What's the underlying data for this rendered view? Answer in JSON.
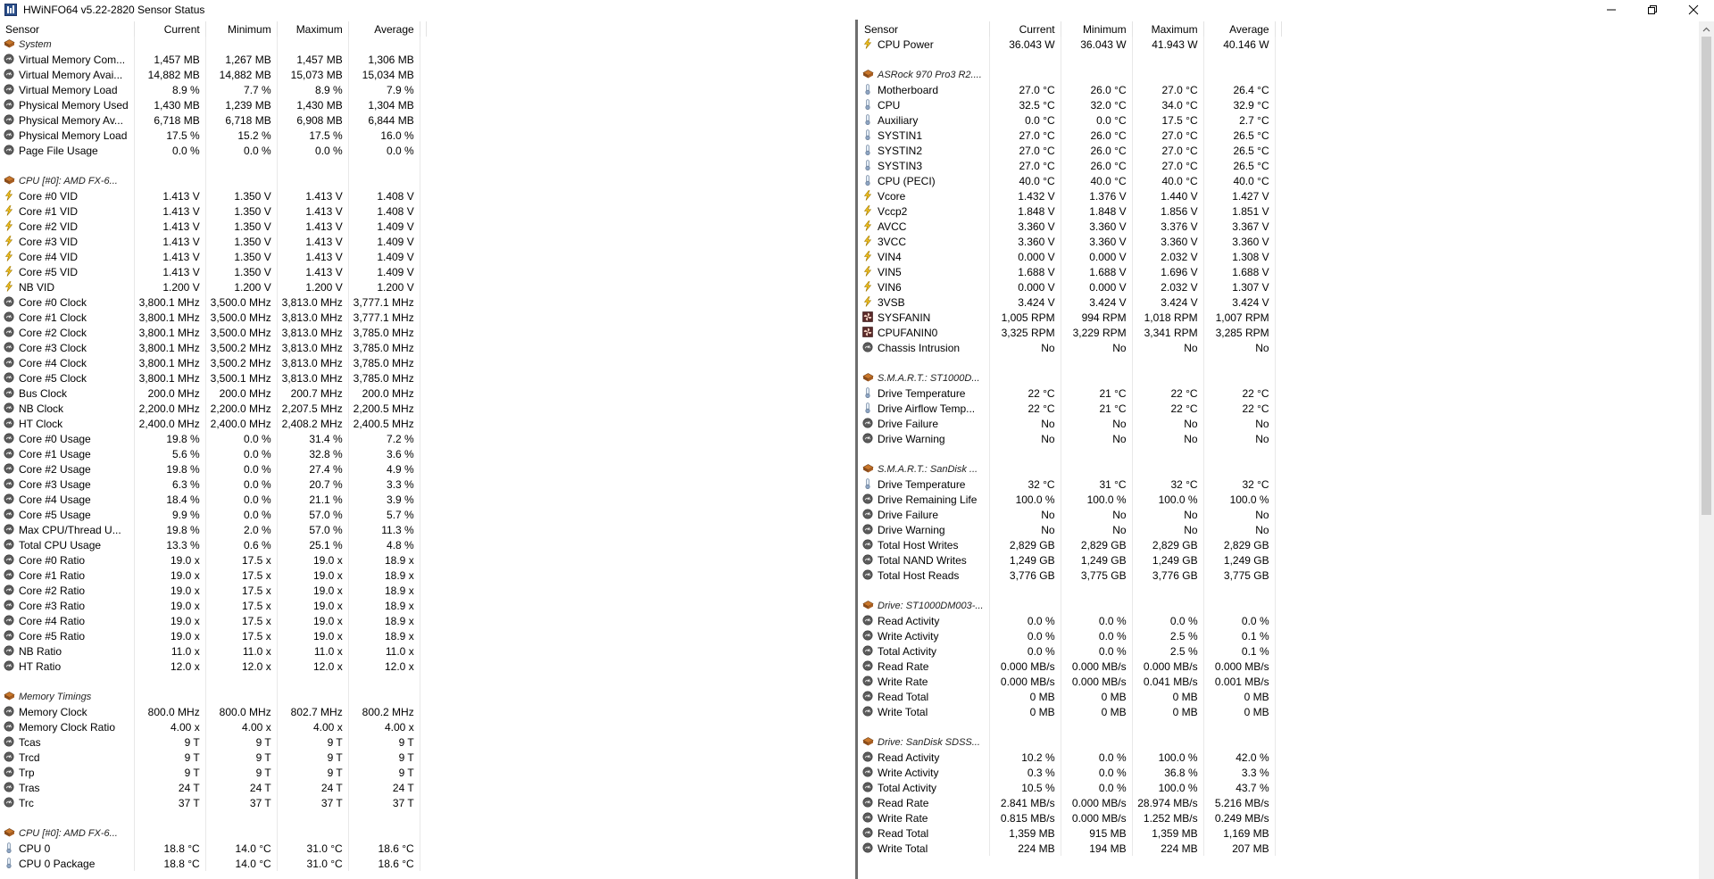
{
  "window": {
    "title": "HWiNFO64 v5.22-2820 Sensor Status"
  },
  "columns": [
    "Sensor",
    "Current",
    "Minimum",
    "Maximum",
    "Average"
  ],
  "left_rows": [
    {
      "type": "section",
      "name": "System"
    },
    {
      "type": "row",
      "icon": "circle",
      "name": "Virtual Memory Com...",
      "cur": "1,457 MB",
      "min": "1,267 MB",
      "max": "1,457 MB",
      "avg": "1,306 MB"
    },
    {
      "type": "row",
      "icon": "circle",
      "name": "Virtual Memory Avai...",
      "cur": "14,882 MB",
      "min": "14,882 MB",
      "max": "15,073 MB",
      "avg": "15,034 MB"
    },
    {
      "type": "row",
      "icon": "circle",
      "name": "Virtual Memory Load",
      "cur": "8.9 %",
      "min": "7.7 %",
      "max": "8.9 %",
      "avg": "7.9 %"
    },
    {
      "type": "row",
      "icon": "circle",
      "name": "Physical Memory Used",
      "cur": "1,430 MB",
      "min": "1,239 MB",
      "max": "1,430 MB",
      "avg": "1,304 MB"
    },
    {
      "type": "row",
      "icon": "circle",
      "name": "Physical Memory Av...",
      "cur": "6,718 MB",
      "min": "6,718 MB",
      "max": "6,908 MB",
      "avg": "6,844 MB"
    },
    {
      "type": "row",
      "icon": "circle",
      "name": "Physical Memory Load",
      "cur": "17.5 %",
      "min": "15.2 %",
      "max": "17.5 %",
      "avg": "16.0 %"
    },
    {
      "type": "row",
      "icon": "circle",
      "name": "Page File Usage",
      "cur": "0.0 %",
      "min": "0.0 %",
      "max": "0.0 %",
      "avg": "0.0 %"
    },
    {
      "type": "blank"
    },
    {
      "type": "section",
      "name": "CPU [#0]: AMD FX-6..."
    },
    {
      "type": "row",
      "icon": "bolt",
      "name": "Core #0 VID",
      "cur": "1.413 V",
      "min": "1.350 V",
      "max": "1.413 V",
      "avg": "1.408 V"
    },
    {
      "type": "row",
      "icon": "bolt",
      "name": "Core #1 VID",
      "cur": "1.413 V",
      "min": "1.350 V",
      "max": "1.413 V",
      "avg": "1.408 V"
    },
    {
      "type": "row",
      "icon": "bolt",
      "name": "Core #2 VID",
      "cur": "1.413 V",
      "min": "1.350 V",
      "max": "1.413 V",
      "avg": "1.409 V"
    },
    {
      "type": "row",
      "icon": "bolt",
      "name": "Core #3 VID",
      "cur": "1.413 V",
      "min": "1.350 V",
      "max": "1.413 V",
      "avg": "1.409 V"
    },
    {
      "type": "row",
      "icon": "bolt",
      "name": "Core #4 VID",
      "cur": "1.413 V",
      "min": "1.350 V",
      "max": "1.413 V",
      "avg": "1.409 V"
    },
    {
      "type": "row",
      "icon": "bolt",
      "name": "Core #5 VID",
      "cur": "1.413 V",
      "min": "1.350 V",
      "max": "1.413 V",
      "avg": "1.409 V"
    },
    {
      "type": "row",
      "icon": "bolt",
      "name": "NB VID",
      "cur": "1.200 V",
      "min": "1.200 V",
      "max": "1.200 V",
      "avg": "1.200 V"
    },
    {
      "type": "row",
      "icon": "circle",
      "name": "Core #0 Clock",
      "cur": "3,800.1 MHz",
      "min": "3,500.0 MHz",
      "max": "3,813.0 MHz",
      "avg": "3,777.1 MHz"
    },
    {
      "type": "row",
      "icon": "circle",
      "name": "Core #1 Clock",
      "cur": "3,800.1 MHz",
      "min": "3,500.0 MHz",
      "max": "3,813.0 MHz",
      "avg": "3,777.1 MHz"
    },
    {
      "type": "row",
      "icon": "circle",
      "name": "Core #2 Clock",
      "cur": "3,800.1 MHz",
      "min": "3,500.0 MHz",
      "max": "3,813.0 MHz",
      "avg": "3,785.0 MHz"
    },
    {
      "type": "row",
      "icon": "circle",
      "name": "Core #3 Clock",
      "cur": "3,800.1 MHz",
      "min": "3,500.2 MHz",
      "max": "3,813.0 MHz",
      "avg": "3,785.0 MHz"
    },
    {
      "type": "row",
      "icon": "circle",
      "name": "Core #4 Clock",
      "cur": "3,800.1 MHz",
      "min": "3,500.2 MHz",
      "max": "3,813.0 MHz",
      "avg": "3,785.0 MHz"
    },
    {
      "type": "row",
      "icon": "circle",
      "name": "Core #5 Clock",
      "cur": "3,800.1 MHz",
      "min": "3,500.1 MHz",
      "max": "3,813.0 MHz",
      "avg": "3,785.0 MHz"
    },
    {
      "type": "row",
      "icon": "circle",
      "name": "Bus Clock",
      "cur": "200.0 MHz",
      "min": "200.0 MHz",
      "max": "200.7 MHz",
      "avg": "200.0 MHz"
    },
    {
      "type": "row",
      "icon": "circle",
      "name": "NB Clock",
      "cur": "2,200.0 MHz",
      "min": "2,200.0 MHz",
      "max": "2,207.5 MHz",
      "avg": "2,200.5 MHz"
    },
    {
      "type": "row",
      "icon": "circle",
      "name": "HT Clock",
      "cur": "2,400.0 MHz",
      "min": "2,400.0 MHz",
      "max": "2,408.2 MHz",
      "avg": "2,400.5 MHz"
    },
    {
      "type": "row",
      "icon": "circle",
      "name": "Core #0 Usage",
      "cur": "19.8 %",
      "min": "0.0 %",
      "max": "31.4 %",
      "avg": "7.2 %"
    },
    {
      "type": "row",
      "icon": "circle",
      "name": "Core #1 Usage",
      "cur": "5.6 %",
      "min": "0.0 %",
      "max": "32.8 %",
      "avg": "3.6 %"
    },
    {
      "type": "row",
      "icon": "circle",
      "name": "Core #2 Usage",
      "cur": "19.8 %",
      "min": "0.0 %",
      "max": "27.4 %",
      "avg": "4.9 %"
    },
    {
      "type": "row",
      "icon": "circle",
      "name": "Core #3 Usage",
      "cur": "6.3 %",
      "min": "0.0 %",
      "max": "20.7 %",
      "avg": "3.3 %"
    },
    {
      "type": "row",
      "icon": "circle",
      "name": "Core #4 Usage",
      "cur": "18.4 %",
      "min": "0.0 %",
      "max": "21.1 %",
      "avg": "3.9 %"
    },
    {
      "type": "row",
      "icon": "circle",
      "name": "Core #5 Usage",
      "cur": "9.9 %",
      "min": "0.0 %",
      "max": "57.0 %",
      "avg": "5.7 %"
    },
    {
      "type": "row",
      "icon": "circle",
      "name": "Max CPU/Thread U...",
      "cur": "19.8 %",
      "min": "2.0 %",
      "max": "57.0 %",
      "avg": "11.3 %"
    },
    {
      "type": "row",
      "icon": "circle",
      "name": "Total CPU Usage",
      "cur": "13.3 %",
      "min": "0.6 %",
      "max": "25.1 %",
      "avg": "4.8 %"
    },
    {
      "type": "row",
      "icon": "circle",
      "name": "Core #0 Ratio",
      "cur": "19.0 x",
      "min": "17.5 x",
      "max": "19.0 x",
      "avg": "18.9 x"
    },
    {
      "type": "row",
      "icon": "circle",
      "name": "Core #1 Ratio",
      "cur": "19.0 x",
      "min": "17.5 x",
      "max": "19.0 x",
      "avg": "18.9 x"
    },
    {
      "type": "row",
      "icon": "circle",
      "name": "Core #2 Ratio",
      "cur": "19.0 x",
      "min": "17.5 x",
      "max": "19.0 x",
      "avg": "18.9 x"
    },
    {
      "type": "row",
      "icon": "circle",
      "name": "Core #3 Ratio",
      "cur": "19.0 x",
      "min": "17.5 x",
      "max": "19.0 x",
      "avg": "18.9 x"
    },
    {
      "type": "row",
      "icon": "circle",
      "name": "Core #4 Ratio",
      "cur": "19.0 x",
      "min": "17.5 x",
      "max": "19.0 x",
      "avg": "18.9 x"
    },
    {
      "type": "row",
      "icon": "circle",
      "name": "Core #5 Ratio",
      "cur": "19.0 x",
      "min": "17.5 x",
      "max": "19.0 x",
      "avg": "18.9 x"
    },
    {
      "type": "row",
      "icon": "circle",
      "name": "NB Ratio",
      "cur": "11.0 x",
      "min": "11.0 x",
      "max": "11.0 x",
      "avg": "11.0 x"
    },
    {
      "type": "row",
      "icon": "circle",
      "name": "HT Ratio",
      "cur": "12.0 x",
      "min": "12.0 x",
      "max": "12.0 x",
      "avg": "12.0 x"
    },
    {
      "type": "blank"
    },
    {
      "type": "section",
      "name": "Memory Timings"
    },
    {
      "type": "row",
      "icon": "circle",
      "name": "Memory Clock",
      "cur": "800.0 MHz",
      "min": "800.0 MHz",
      "max": "802.7 MHz",
      "avg": "800.2 MHz"
    },
    {
      "type": "row",
      "icon": "circle",
      "name": "Memory Clock Ratio",
      "cur": "4.00 x",
      "min": "4.00 x",
      "max": "4.00 x",
      "avg": "4.00 x"
    },
    {
      "type": "row",
      "icon": "circle",
      "name": "Tcas",
      "cur": "9 T",
      "min": "9 T",
      "max": "9 T",
      "avg": "9 T"
    },
    {
      "type": "row",
      "icon": "circle",
      "name": "Trcd",
      "cur": "9 T",
      "min": "9 T",
      "max": "9 T",
      "avg": "9 T"
    },
    {
      "type": "row",
      "icon": "circle",
      "name": "Trp",
      "cur": "9 T",
      "min": "9 T",
      "max": "9 T",
      "avg": "9 T"
    },
    {
      "type": "row",
      "icon": "circle",
      "name": "Tras",
      "cur": "24 T",
      "min": "24 T",
      "max": "24 T",
      "avg": "24 T"
    },
    {
      "type": "row",
      "icon": "circle",
      "name": "Trc",
      "cur": "37 T",
      "min": "37 T",
      "max": "37 T",
      "avg": "37 T"
    },
    {
      "type": "blank"
    },
    {
      "type": "section",
      "name": "CPU [#0]: AMD FX-6..."
    },
    {
      "type": "row",
      "icon": "thermo",
      "name": "CPU 0",
      "cur": "18.8 °C",
      "min": "14.0 °C",
      "max": "31.0 °C",
      "avg": "18.6 °C"
    },
    {
      "type": "row",
      "icon": "thermo",
      "name": "CPU 0 Package",
      "cur": "18.8 °C",
      "min": "14.0 °C",
      "max": "31.0 °C",
      "avg": "18.6 °C"
    }
  ],
  "right_rows": [
    {
      "type": "row",
      "icon": "bolt",
      "name": "CPU Power",
      "cur": "36.043 W",
      "min": "36.043 W",
      "max": "41.943 W",
      "avg": "40.146 W"
    },
    {
      "type": "blank"
    },
    {
      "type": "section",
      "name": "ASRock 970 Pro3 R2...."
    },
    {
      "type": "row",
      "icon": "thermo",
      "name": "Motherboard",
      "cur": "27.0 °C",
      "min": "26.0 °C",
      "max": "27.0 °C",
      "avg": "26.4 °C"
    },
    {
      "type": "row",
      "icon": "thermo",
      "name": "CPU",
      "cur": "32.5 °C",
      "min": "32.0 °C",
      "max": "34.0 °C",
      "avg": "32.9 °C"
    },
    {
      "type": "row",
      "icon": "thermo",
      "name": "Auxiliary",
      "cur": "0.0 °C",
      "min": "0.0 °C",
      "max": "17.5 °C",
      "avg": "2.7 °C"
    },
    {
      "type": "row",
      "icon": "thermo",
      "name": "SYSTIN1",
      "cur": "27.0 °C",
      "min": "26.0 °C",
      "max": "27.0 °C",
      "avg": "26.5 °C"
    },
    {
      "type": "row",
      "icon": "thermo",
      "name": "SYSTIN2",
      "cur": "27.0 °C",
      "min": "26.0 °C",
      "max": "27.0 °C",
      "avg": "26.5 °C"
    },
    {
      "type": "row",
      "icon": "thermo",
      "name": "SYSTIN3",
      "cur": "27.0 °C",
      "min": "26.0 °C",
      "max": "27.0 °C",
      "avg": "26.5 °C"
    },
    {
      "type": "row",
      "icon": "thermo",
      "name": "CPU (PECI)",
      "cur": "40.0 °C",
      "min": "40.0 °C",
      "max": "40.0 °C",
      "avg": "40.0 °C"
    },
    {
      "type": "row",
      "icon": "bolt",
      "name": "Vcore",
      "cur": "1.432 V",
      "min": "1.376 V",
      "max": "1.440 V",
      "avg": "1.427 V"
    },
    {
      "type": "row",
      "icon": "bolt",
      "name": "Vccp2",
      "cur": "1.848 V",
      "min": "1.848 V",
      "max": "1.856 V",
      "avg": "1.851 V"
    },
    {
      "type": "row",
      "icon": "bolt",
      "name": "AVCC",
      "cur": "3.360 V",
      "min": "3.360 V",
      "max": "3.376 V",
      "avg": "3.367 V"
    },
    {
      "type": "row",
      "icon": "bolt",
      "name": "3VCC",
      "cur": "3.360 V",
      "min": "3.360 V",
      "max": "3.360 V",
      "avg": "3.360 V"
    },
    {
      "type": "row",
      "icon": "bolt",
      "name": "VIN4",
      "cur": "0.000 V",
      "min": "0.000 V",
      "max": "2.032 V",
      "avg": "1.308 V"
    },
    {
      "type": "row",
      "icon": "bolt",
      "name": "VIN5",
      "cur": "1.688 V",
      "min": "1.688 V",
      "max": "1.696 V",
      "avg": "1.688 V"
    },
    {
      "type": "row",
      "icon": "bolt",
      "name": "VIN6",
      "cur": "0.000 V",
      "min": "0.000 V",
      "max": "2.032 V",
      "avg": "1.307 V"
    },
    {
      "type": "row",
      "icon": "bolt",
      "name": "3VSB",
      "cur": "3.424 V",
      "min": "3.424 V",
      "max": "3.424 V",
      "avg": "3.424 V"
    },
    {
      "type": "row",
      "icon": "fan",
      "name": "SYSFANIN",
      "cur": "1,005 RPM",
      "min": "994 RPM",
      "max": "1,018 RPM",
      "avg": "1,007 RPM"
    },
    {
      "type": "row",
      "icon": "fan",
      "name": "CPUFANIN0",
      "cur": "3,325 RPM",
      "min": "3,229 RPM",
      "max": "3,341 RPM",
      "avg": "3,285 RPM"
    },
    {
      "type": "row",
      "icon": "circle",
      "name": "Chassis Intrusion",
      "cur": "No",
      "min": "No",
      "max": "No",
      "avg": "No"
    },
    {
      "type": "blank"
    },
    {
      "type": "section",
      "name": "S.M.A.R.T.: ST1000D..."
    },
    {
      "type": "row",
      "icon": "thermo",
      "name": "Drive Temperature",
      "cur": "22 °C",
      "min": "21 °C",
      "max": "22 °C",
      "avg": "22 °C"
    },
    {
      "type": "row",
      "icon": "thermo",
      "name": "Drive Airflow Temp...",
      "cur": "22 °C",
      "min": "21 °C",
      "max": "22 °C",
      "avg": "22 °C"
    },
    {
      "type": "row",
      "icon": "circle",
      "name": "Drive Failure",
      "cur": "No",
      "min": "No",
      "max": "No",
      "avg": "No"
    },
    {
      "type": "row",
      "icon": "circle",
      "name": "Drive Warning",
      "cur": "No",
      "min": "No",
      "max": "No",
      "avg": "No"
    },
    {
      "type": "blank"
    },
    {
      "type": "section",
      "name": "S.M.A.R.T.: SanDisk ..."
    },
    {
      "type": "row",
      "icon": "thermo",
      "name": "Drive Temperature",
      "cur": "32 °C",
      "min": "31 °C",
      "max": "32 °C",
      "avg": "32 °C"
    },
    {
      "type": "row",
      "icon": "circle",
      "name": "Drive Remaining Life",
      "cur": "100.0 %",
      "min": "100.0 %",
      "max": "100.0 %",
      "avg": "100.0 %"
    },
    {
      "type": "row",
      "icon": "circle",
      "name": "Drive Failure",
      "cur": "No",
      "min": "No",
      "max": "No",
      "avg": "No"
    },
    {
      "type": "row",
      "icon": "circle",
      "name": "Drive Warning",
      "cur": "No",
      "min": "No",
      "max": "No",
      "avg": "No"
    },
    {
      "type": "row",
      "icon": "circle",
      "name": "Total Host Writes",
      "cur": "2,829 GB",
      "min": "2,829 GB",
      "max": "2,829 GB",
      "avg": "2,829 GB"
    },
    {
      "type": "row",
      "icon": "circle",
      "name": "Total NAND Writes",
      "cur": "1,249 GB",
      "min": "1,249 GB",
      "max": "1,249 GB",
      "avg": "1,249 GB"
    },
    {
      "type": "row",
      "icon": "circle",
      "name": "Total Host Reads",
      "cur": "3,776 GB",
      "min": "3,775 GB",
      "max": "3,776 GB",
      "avg": "3,775 GB"
    },
    {
      "type": "blank"
    },
    {
      "type": "section",
      "name": "Drive: ST1000DM003-..."
    },
    {
      "type": "row",
      "icon": "circle",
      "name": "Read Activity",
      "cur": "0.0 %",
      "min": "0.0 %",
      "max": "0.0 %",
      "avg": "0.0 %"
    },
    {
      "type": "row",
      "icon": "circle",
      "name": "Write Activity",
      "cur": "0.0 %",
      "min": "0.0 %",
      "max": "2.5 %",
      "avg": "0.1 %"
    },
    {
      "type": "row",
      "icon": "circle",
      "name": "Total Activity",
      "cur": "0.0 %",
      "min": "0.0 %",
      "max": "2.5 %",
      "avg": "0.1 %"
    },
    {
      "type": "row",
      "icon": "circle",
      "name": "Read Rate",
      "cur": "0.000 MB/s",
      "min": "0.000 MB/s",
      "max": "0.000 MB/s",
      "avg": "0.000 MB/s"
    },
    {
      "type": "row",
      "icon": "circle",
      "name": "Write Rate",
      "cur": "0.000 MB/s",
      "min": "0.000 MB/s",
      "max": "0.041 MB/s",
      "avg": "0.001 MB/s"
    },
    {
      "type": "row",
      "icon": "circle",
      "name": "Read Total",
      "cur": "0 MB",
      "min": "0 MB",
      "max": "0 MB",
      "avg": "0 MB"
    },
    {
      "type": "row",
      "icon": "circle",
      "name": "Write Total",
      "cur": "0 MB",
      "min": "0 MB",
      "max": "0 MB",
      "avg": "0 MB"
    },
    {
      "type": "blank"
    },
    {
      "type": "section",
      "name": "Drive: SanDisk SDSS..."
    },
    {
      "type": "row",
      "icon": "circle",
      "name": "Read Activity",
      "cur": "10.2 %",
      "min": "0.0 %",
      "max": "100.0 %",
      "avg": "42.0 %"
    },
    {
      "type": "row",
      "icon": "circle",
      "name": "Write Activity",
      "cur": "0.3 %",
      "min": "0.0 %",
      "max": "36.8 %",
      "avg": "3.3 %"
    },
    {
      "type": "row",
      "icon": "circle",
      "name": "Total Activity",
      "cur": "10.5 %",
      "min": "0.0 %",
      "max": "100.0 %",
      "avg": "43.7 %"
    },
    {
      "type": "row",
      "icon": "circle",
      "name": "Read Rate",
      "cur": "2.841 MB/s",
      "min": "0.000 MB/s",
      "max": "28.974 MB/s",
      "avg": "5.216 MB/s"
    },
    {
      "type": "row",
      "icon": "circle",
      "name": "Write Rate",
      "cur": "0.815 MB/s",
      "min": "0.000 MB/s",
      "max": "1.252 MB/s",
      "avg": "0.249 MB/s"
    },
    {
      "type": "row",
      "icon": "circle",
      "name": "Read Total",
      "cur": "1,359 MB",
      "min": "915 MB",
      "max": "1,359 MB",
      "avg": "1,169 MB"
    },
    {
      "type": "row",
      "icon": "circle",
      "name": "Write Total",
      "cur": "224 MB",
      "min": "194 MB",
      "max": "224 MB",
      "avg": "207 MB"
    }
  ],
  "icons": {
    "circle": "gauge-icon",
    "bolt": "voltage-icon",
    "thermo": "thermometer-icon",
    "fan": "fan-icon",
    "chip": "chip-icon"
  },
  "colors": {
    "bolt": "#e8b400",
    "gauge": "#555555",
    "thermo": "#7a8fa8",
    "fan": "#5a2a2a"
  }
}
